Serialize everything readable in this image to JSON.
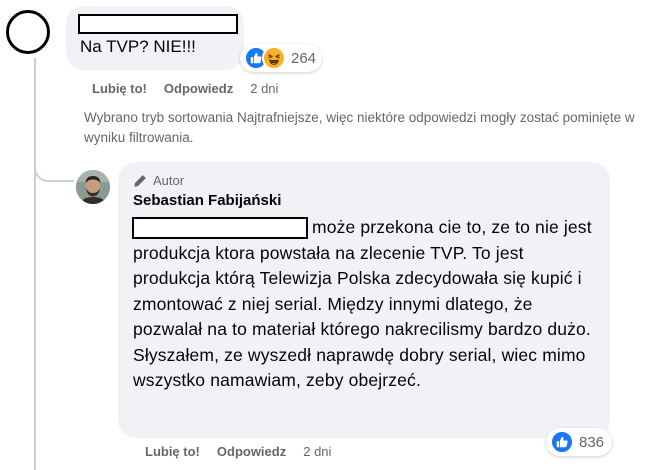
{
  "comment1": {
    "text": "Na TVP? NIE!!!",
    "reaction_count": "264",
    "reactions": [
      "like-icon",
      "haha-icon"
    ],
    "actions": {
      "like": "Lubię to!",
      "reply": "Odpowiedz",
      "time": "2 dni"
    }
  },
  "sort_note": "Wybrano tryb sortowania Najtrafniejsze, więc niektóre odpowiedzi mogły zostać pominięte w wyniku filtrowania.",
  "reply": {
    "badge": "Autor",
    "author": "Sebastian Fabijański",
    "text": "może przekona cie to, ze to nie jest produkcja ktora powstała na zlecenie TVP. To jest produkcja którą Telewizja Polska zdecydowała się kupić i zmontować z niej serial. Między innymi dlatego, że pozwalał na to materiał którego nakrecilismy bardzo dużo. Słyszałem, ze wyszedł naprawdę dobry serial, wiec mimo wszystko namawiam, zeby obejrzeć.",
    "reaction_count": "836",
    "reactions": [
      "like-icon"
    ],
    "actions": {
      "like": "Lubię to!",
      "reply": "Odpowiedz",
      "time": "2 dni"
    }
  },
  "colors": {
    "bubble": "#f0f2f5",
    "secondary_text": "#65676b",
    "like_blue": "#1877f2",
    "haha_yellow": "#f7b125"
  }
}
